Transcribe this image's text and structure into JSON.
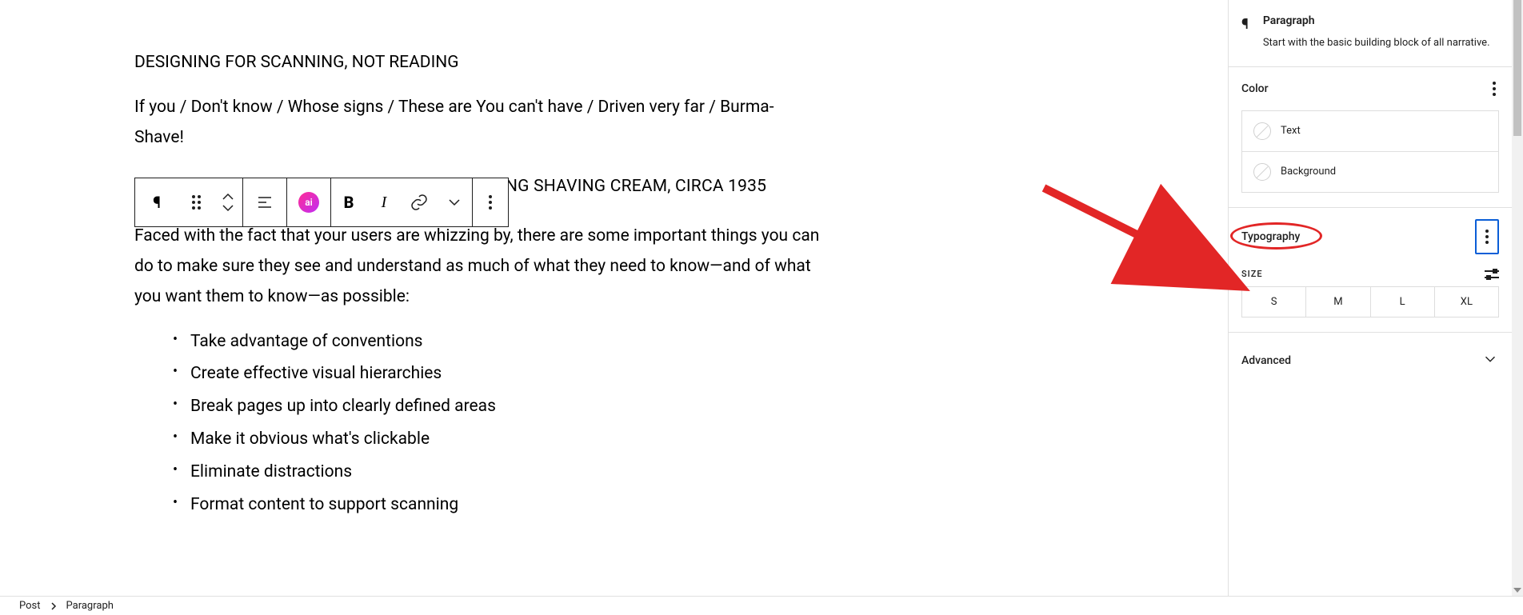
{
  "content": {
    "heading": "DESIGNING FOR SCANNING, NOT READING",
    "p1": "If you / Don't know / Whose signs / These are You can't have / Driven very far / Burma-Shave!",
    "subnote": "NG SHAVING CREAM, CIRCA 1935",
    "p2": "Faced with the fact that your users are whizzing by, there are some important things you can do to make sure they see and understand as much of what they need to know—and of what you want them to know—as possible:",
    "bullets": [
      "Take advantage of conventions",
      "Create effective visual hierarchies",
      "Break pages up into clearly defined areas",
      "Make it obvious what's clickable",
      "Eliminate distractions",
      "Format content to support scanning"
    ]
  },
  "toolbar": {
    "ai_label": "ai"
  },
  "sidebar": {
    "block_title": "Paragraph",
    "block_desc": "Start with the basic building block of all narrative.",
    "color_label": "Color",
    "color_text": "Text",
    "color_bg": "Background",
    "typography_label": "Typography",
    "size_label": "SIZE",
    "sizes": [
      "S",
      "M",
      "L",
      "XL"
    ],
    "advanced_label": "Advanced"
  },
  "breadcrumb": {
    "post": "Post",
    "current": "Paragraph"
  }
}
